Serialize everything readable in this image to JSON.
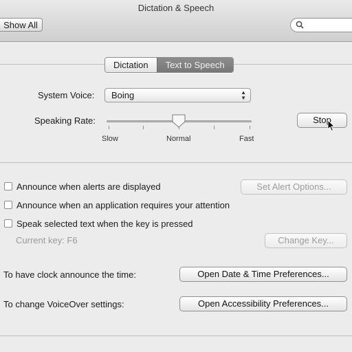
{
  "window": {
    "title": "Dictation & Speech"
  },
  "toolbar": {
    "show_all_label": "Show All",
    "search_placeholder": "",
    "search_icon": "search-icon"
  },
  "tabs": [
    {
      "label": "Dictation",
      "selected": false
    },
    {
      "label": "Text to Speech",
      "selected": true
    }
  ],
  "system_voice": {
    "label": "System Voice:",
    "value": "Boing"
  },
  "speaking_rate": {
    "label": "Speaking Rate:",
    "slow_label": "Slow",
    "normal_label": "Normal",
    "fast_label": "Fast",
    "value_fraction": 0.5,
    "stop_button": "Stop"
  },
  "options": {
    "alerts": {
      "label": "Announce when alerts are displayed",
      "checked": false,
      "button": "Set Alert Options..."
    },
    "app_attention": {
      "label": "Announce when an application requires your attention",
      "checked": false
    },
    "speak_selected": {
      "label": "Speak selected text when the key is pressed",
      "checked": false,
      "current_key": "Current key: F6",
      "button": "Change Key..."
    }
  },
  "clock": {
    "label": "To have clock announce the time:",
    "button": "Open Date & Time Preferences..."
  },
  "voiceover": {
    "label": "To change VoiceOver settings:",
    "button": "Open Accessibility Preferences..."
  }
}
